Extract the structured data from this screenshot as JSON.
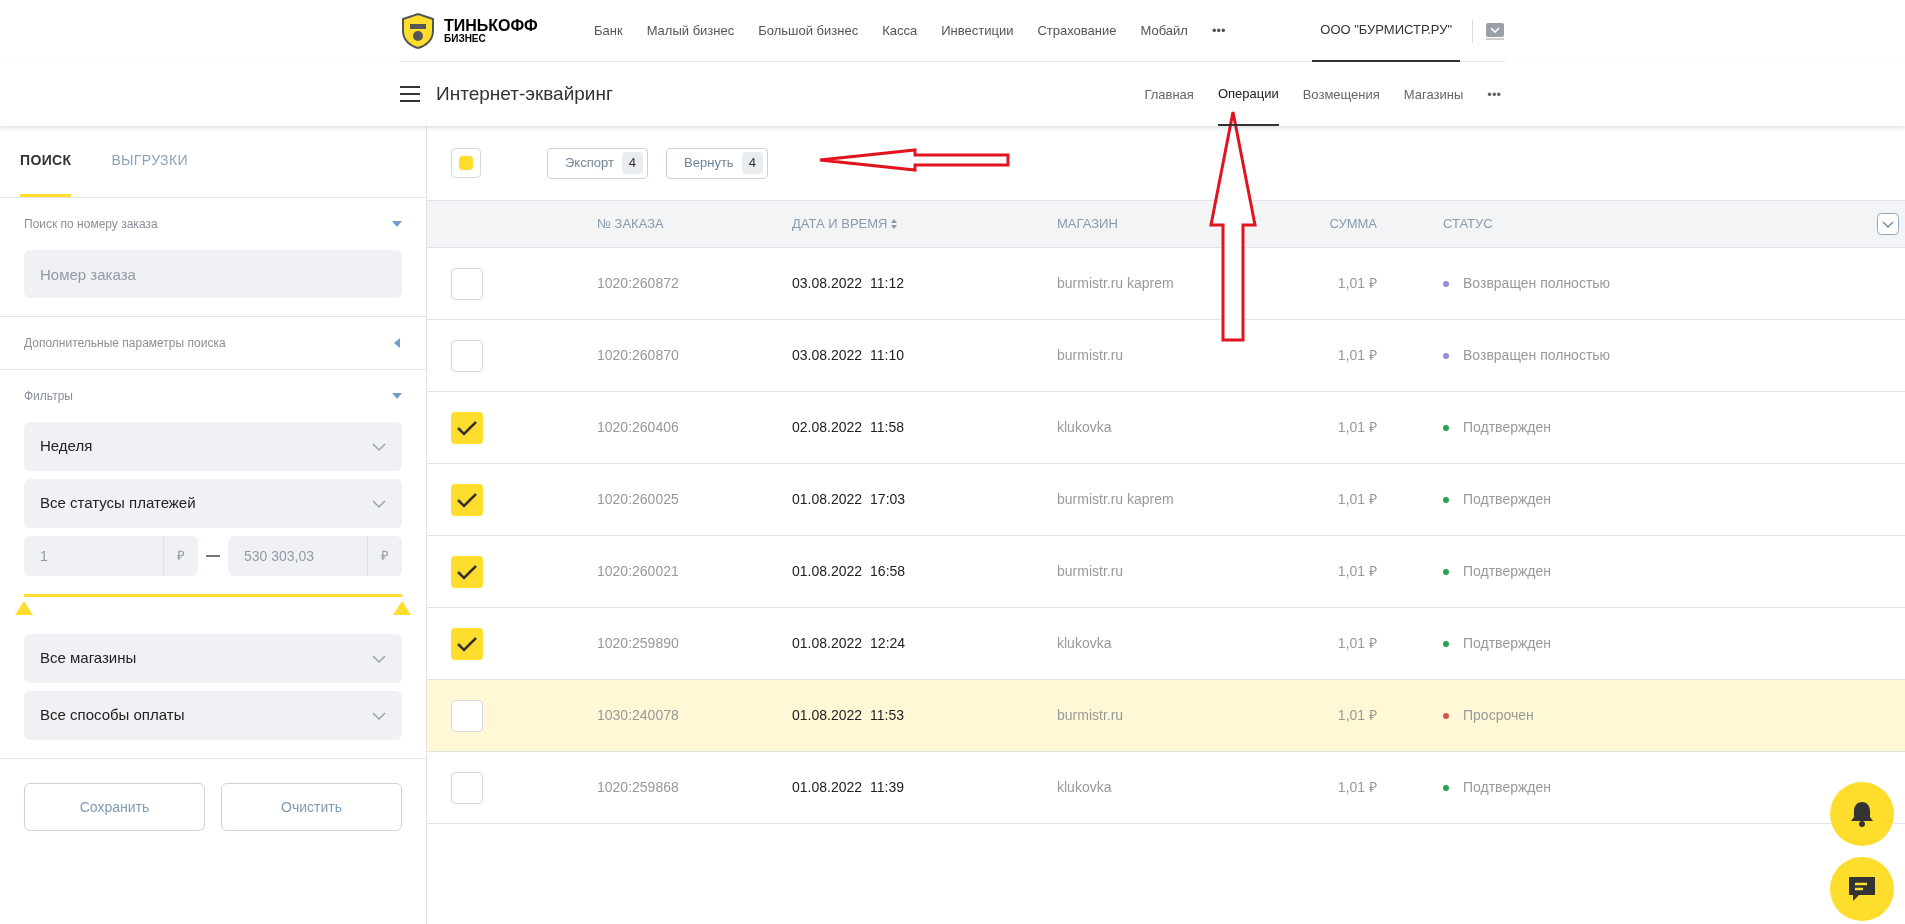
{
  "brand": {
    "name": "ТИНЬКОФФ",
    "sub": "БИЗНЕС"
  },
  "top_nav": [
    {
      "label": "Банк"
    },
    {
      "label": "Малый бизнес"
    },
    {
      "label": "Большой бизнес"
    },
    {
      "label": "Касса"
    },
    {
      "label": "Инвестиции"
    },
    {
      "label": "Страхование"
    },
    {
      "label": "Мобайл"
    },
    {
      "label": "•••"
    }
  ],
  "company": {
    "label": "ООО \"БУРМИСТР.РУ\"",
    "selected": true
  },
  "section": {
    "title": "Интернет-эквайринг"
  },
  "section_tabs": [
    {
      "label": "Главная",
      "selected": false
    },
    {
      "label": "Операции",
      "selected": true
    },
    {
      "label": "Возмещения",
      "selected": false
    },
    {
      "label": "Магазины",
      "selected": false
    },
    {
      "label": "•••",
      "selected": false
    }
  ],
  "sidebar": {
    "tabs": [
      {
        "label": "ПОИСК",
        "selected": true
      },
      {
        "label": "ВЫГРУЗКИ",
        "selected": false
      }
    ],
    "sections": [
      {
        "title": "Поиск по номеру заказа",
        "expanded": true
      },
      {
        "title": "Дополнительные параметры поиска",
        "expanded": false
      },
      {
        "title": "Фильтры",
        "expanded": true
      }
    ],
    "order_field": {
      "placeholder": "Номер заказа"
    },
    "period": "Неделя",
    "payment_status": "Все статусы платежей",
    "amount_from": {
      "placeholder": "1",
      "currency": "₽"
    },
    "amount_to": {
      "placeholder": "530 303,03",
      "currency": "₽"
    },
    "slider_thumbs": [
      {
        "level": 0
      },
      {
        "level": 1
      }
    ],
    "shop": "Все магазины",
    "payment_method": "Все способы оплаты",
    "buttons": [
      "Сохранить",
      "Очистить"
    ]
  },
  "toolbar": {
    "select_all": {
      "indeterminate": true
    },
    "actions": [
      {
        "label": "Экспорт",
        "count": "4"
      },
      {
        "label": "Вернуть",
        "count": "4"
      }
    ]
  },
  "table": {
    "columns": [
      "№ ЗАКАЗА",
      "ДАТА И ВРЕМЯ",
      "МАГАЗИН",
      "СУММА",
      "СТАТУС"
    ],
    "rows": [
      {
        "selected": false,
        "highlighted": false,
        "order": "1020:260872",
        "date": "03.08.2022",
        "time": "11:12",
        "shop": "burmistr.ru kaprem",
        "sum": "1,01 ₽",
        "status": "Возвращен полностью",
        "color": "#9b8ad6"
      },
      {
        "selected": false,
        "highlighted": false,
        "order": "1020:260870",
        "date": "03.08.2022",
        "time": "11:10",
        "shop": "burmistr.ru",
        "sum": "1,01 ₽",
        "status": "Возвращен полностью",
        "color": "#9b8ad6"
      },
      {
        "selected": true,
        "highlighted": false,
        "order": "1020:260406",
        "date": "02.08.2022",
        "time": "11:58",
        "shop": "klukovka",
        "sum": "1,01 ₽",
        "status": "Подтвержден",
        "color": "#2e9e5b"
      },
      {
        "selected": true,
        "highlighted": false,
        "order": "1020:260025",
        "date": "01.08.2022",
        "time": "17:03",
        "shop": "burmistr.ru kaprem",
        "sum": "1,01 ₽",
        "status": "Подтвержден",
        "color": "#2e9e5b"
      },
      {
        "selected": true,
        "highlighted": false,
        "order": "1020:260021",
        "date": "01.08.2022",
        "time": "16:58",
        "shop": "burmistr.ru",
        "sum": "1,01 ₽",
        "status": "Подтвержден",
        "color": "#2e9e5b"
      },
      {
        "selected": true,
        "highlighted": false,
        "order": "1020:259890",
        "date": "01.08.2022",
        "time": "12:24",
        "shop": "klukovka",
        "sum": "1,01 ₽",
        "status": "Подтвержден",
        "color": "#2e9e5b"
      },
      {
        "selected": false,
        "highlighted": true,
        "order": "1030:240078",
        "date": "01.08.2022",
        "time": "11:53",
        "shop": "burmistr.ru",
        "sum": "1,01 ₽",
        "status": "Просрочен",
        "color": "#d9534f"
      },
      {
        "selected": false,
        "highlighted": false,
        "order": "1020:259868",
        "date": "01.08.2022",
        "time": "11:39",
        "shop": "klukovka",
        "sum": "1,01 ₽",
        "status": "Подтвержден",
        "color": "#2e9e5b"
      }
    ]
  }
}
